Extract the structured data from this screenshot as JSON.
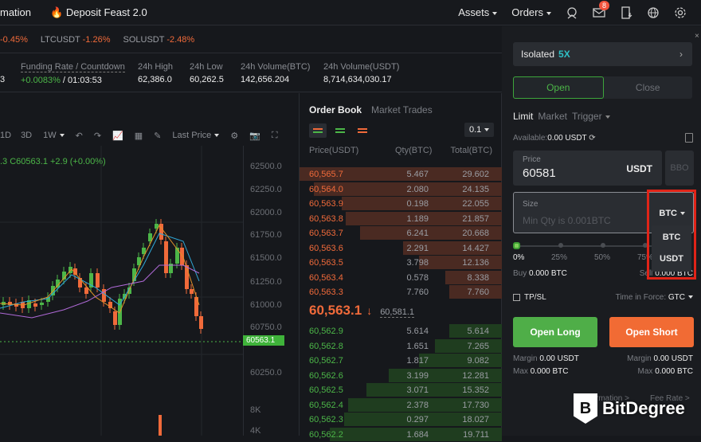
{
  "topbar": {
    "nav": [
      {
        "label": "mation"
      },
      {
        "label": "Deposit Feast 2.0",
        "icon": "fire-icon"
      }
    ],
    "right": [
      {
        "label": "Assets"
      },
      {
        "label": "Orders"
      }
    ],
    "icons": [
      "support-icon",
      "mail-icon",
      "download-app-icon",
      "globe-icon",
      "settings-icon"
    ],
    "mail_badge": "8"
  },
  "ticker": [
    {
      "pair": "",
      "change": "-0.45%"
    },
    {
      "pair": "LTCUSDT",
      "change": "-1.26%"
    },
    {
      "pair": "SOLUSDT",
      "change": "-2.48%"
    }
  ],
  "stats": {
    "partial_value": "3",
    "funding": {
      "label": "Funding Rate / Countdown",
      "rate": "+0.0083%",
      "countdown": "/ 01:03:53"
    },
    "high": {
      "label": "24h High",
      "value": "62,386.0"
    },
    "low": {
      "label": "24h Low",
      "value": "60,262.5"
    },
    "vol_btc": {
      "label": "24h Volume(BTC)",
      "value": "142,656.204"
    },
    "vol_usdt": {
      "label": "24h Volume(USDT)",
      "value": "8,714,634,030.17"
    }
  },
  "chart": {
    "toolbar": [
      "1D",
      "3D",
      "1W",
      "Last Price"
    ],
    "ohlc": ".3  C60563.1  +2.9 (+0.00%)",
    "yticks": [
      "62500.0",
      "62250.0",
      "62000.0",
      "61750.0",
      "61500.0",
      "61250.0",
      "61000.0",
      "60750.0",
      "60250.0"
    ],
    "vol_ticks": [
      "8K",
      "4K"
    ],
    "last_price": "60563.1"
  },
  "orderbook": {
    "tabs": [
      "Order Book",
      "Market Trades"
    ],
    "precision": "0.1",
    "headers": [
      "Price(USDT)",
      "Qty(BTC)",
      "Total(BTC)"
    ],
    "asks": [
      {
        "price": "60,565.7",
        "qty": "5.467",
        "total": "29.602",
        "depth": 1.0
      },
      {
        "price": "60,564.0",
        "qty": "2.080",
        "total": "24.135",
        "depth": 0.93
      },
      {
        "price": "60,563.9",
        "qty": "0.198",
        "total": "22.055",
        "depth": 0.79
      },
      {
        "price": "60,563.8",
        "qty": "1.189",
        "total": "21.857",
        "depth": 0.77
      },
      {
        "price": "60,563.7",
        "qty": "6.241",
        "total": "20.668",
        "depth": 0.7
      },
      {
        "price": "60,563.6",
        "qty": "2.291",
        "total": "14.427",
        "depth": 0.49
      },
      {
        "price": "60,563.5",
        "qty": "3.798",
        "total": "12.136",
        "depth": 0.41
      },
      {
        "price": "60,563.4",
        "qty": "0.578",
        "total": "8.338",
        "depth": 0.28
      },
      {
        "price": "60,563.3",
        "qty": "7.760",
        "total": "7.760",
        "depth": 0.26
      }
    ],
    "mid": {
      "price": "60,563.1",
      "arrow": "↓",
      "mark": "60,581.1"
    },
    "bids": [
      {
        "price": "60,562.9",
        "qty": "5.614",
        "total": "5.614",
        "depth": 0.26
      },
      {
        "price": "60,562.8",
        "qty": "1.651",
        "total": "7.265",
        "depth": 0.33
      },
      {
        "price": "60,562.7",
        "qty": "1.817",
        "total": "9.082",
        "depth": 0.41
      },
      {
        "price": "60,562.6",
        "qty": "3.199",
        "total": "12.281",
        "depth": 0.56
      },
      {
        "price": "60,562.5",
        "qty": "3.071",
        "total": "15.352",
        "depth": 0.67
      },
      {
        "price": "60,562.4",
        "qty": "2.378",
        "total": "17.730",
        "depth": 0.76
      },
      {
        "price": "60,562.3",
        "qty": "0.297",
        "total": "18.027",
        "depth": 0.78
      },
      {
        "price": "60,562.2",
        "qty": "1.684",
        "total": "19.711",
        "depth": 0.85
      }
    ]
  },
  "panel": {
    "margin_mode": "Isolated",
    "leverage": "5X",
    "open_label": "Open",
    "close_label": "Close",
    "order_types": [
      "Limit",
      "Market",
      "Trigger"
    ],
    "available_label": "Available:",
    "available_value": "0.00 USDT",
    "price_label": "Price",
    "price_value": "60581",
    "price_unit": "USDT",
    "bbo": "BBO",
    "size_label": "Size",
    "size_placeholder": "Min Qty is 0.001BTC",
    "size_unit": "BTC",
    "unit_options": [
      "BTC",
      "USDT"
    ],
    "slider_value": 0,
    "slider_labels": [
      "0%",
      "25%",
      "50%",
      "75%"
    ],
    "buy_label": "Buy",
    "buy_value": "0.000 BTC",
    "sell_label": "Sell",
    "sell_value": "0.000 BTC",
    "tpsl": "TP/SL",
    "tif_label": "Time in Force:",
    "tif_value": "GTC",
    "open_long": "Open Long",
    "open_short": "Open Short",
    "margin_label": "Margin",
    "margin_value": "0.00 USDT",
    "max_label": "Max",
    "max_value": "0.000 BTC",
    "footer": [
      "rmation >",
      "Fee Rate >"
    ]
  },
  "watermark": "BitDegree"
}
